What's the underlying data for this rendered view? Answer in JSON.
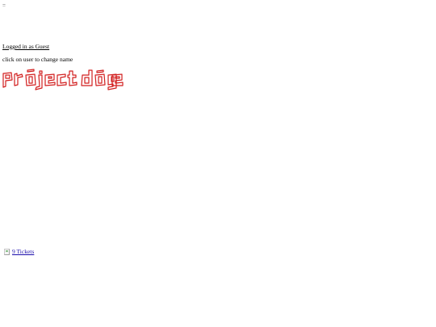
{
  "menu": {
    "glyph": "="
  },
  "header": {
    "login_text": "Logged in as Guest",
    "hint": "click on user to change name"
  },
  "logo": {
    "text": "project doge",
    "color": "#d21f1f",
    "icon": "project-doge-logo"
  },
  "footer": {
    "tickets_icon": "broken-image-icon",
    "tickets_label": "9 Tickets"
  },
  "colors": {
    "link": "#1a0dab",
    "logo_red": "#d21f1f"
  }
}
